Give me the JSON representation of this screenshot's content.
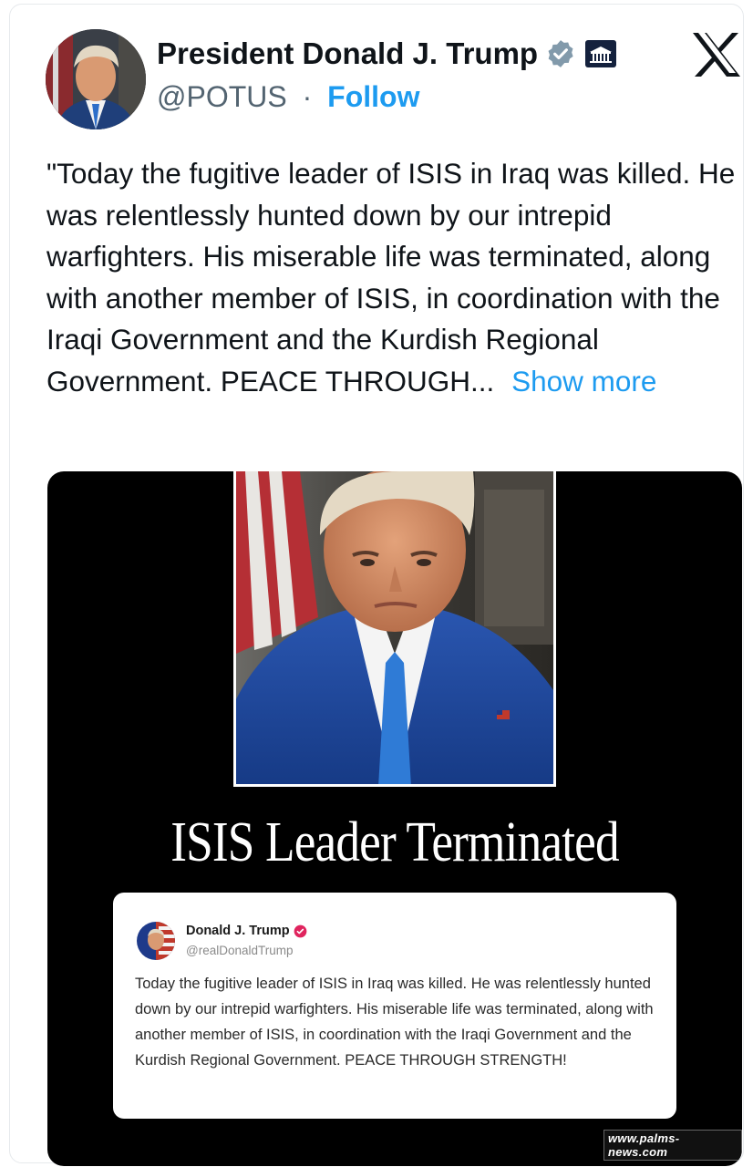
{
  "author": {
    "display_name": "President Donald J. Trump",
    "handle": "@POTUS",
    "separator": "·",
    "follow_label": "Follow"
  },
  "tweet": {
    "text": "\"Today the fugitive leader of ISIS in Iraq was killed. He was relentlessly hunted down by our intrepid warfighters. His miserable life was terminated, along with another member of ISIS, in coordination with the Iraqi Government and the Kurdish Regional Government. PEACE THROUGH...",
    "show_more_label": "Show more"
  },
  "media": {
    "headline": "ISIS Leader Terminated",
    "quoted_post": {
      "name": "Donald J. Trump",
      "handle": "@realDonaldTrump",
      "text": "Today the fugitive leader of ISIS in Iraq was killed. He was relentlessly hunted down by our intrepid warfighters. His miserable life was terminated, along with another member of ISIS, in coordination with the Iraqi Government and the Kurdish Regional Government. PEACE THROUGH STRENGTH!"
    },
    "watermark": "www.palms-news.com"
  },
  "colors": {
    "link_blue": "#1d9bf0",
    "verified_gray": "#829aab",
    "quote_verified_pink": "#e0245e",
    "media_bg": "#000000"
  },
  "icons": {
    "verified": "verified-badge-icon",
    "affiliation": "white-house-icon",
    "platform": "x-logo-icon"
  }
}
